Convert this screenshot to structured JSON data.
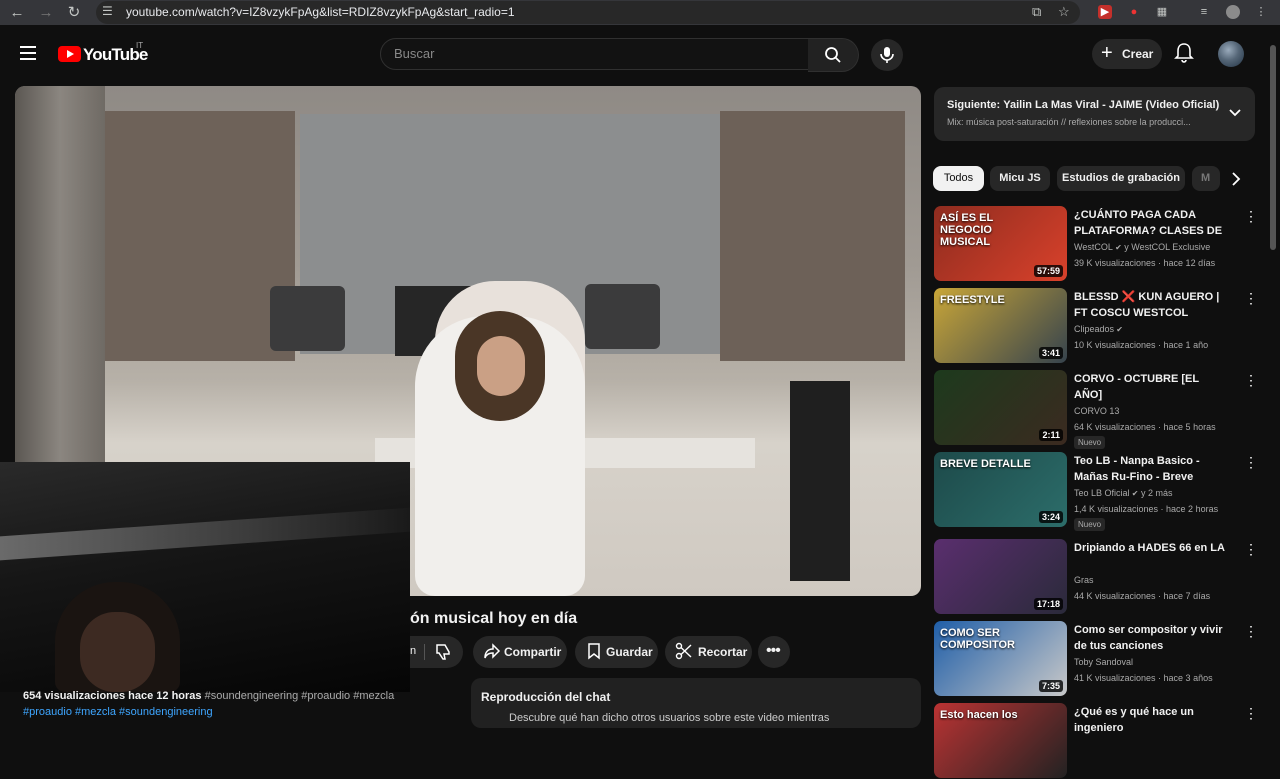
{
  "browser": {
    "url": "youtube.com/watch?v=IZ8vzykFpAg&list=RDIZ8vzykFpAg&start_radio=1"
  },
  "header": {
    "logo_text": "YouTube",
    "country_code": "IT",
    "search_placeholder": "Buscar",
    "create_label": "Crear"
  },
  "video": {
    "title_fragment": "ón musical hoy en día",
    "like_fragment": "n",
    "actions": {
      "share": "Compartir",
      "save": "Guardar",
      "clip": "Recortar"
    },
    "views": "654 visualizaciones  hace 12 horas",
    "hashtags_line1": "#soundengineering #proaudio #mezcla",
    "hashtags_line2": "#proaudio #mezcla #soundengineering"
  },
  "chat_replay": {
    "title": "Reproducción del chat",
    "subtitle": "Descubre qué han dicho otros usuarios sobre este video mientras"
  },
  "up_next": {
    "label": "Siguiente:",
    "title": "Yailin La Mas Viral - JAIME (Video Oficial)",
    "subtitle": "Mix: música post-saturación // reflexiones sobre la producci..."
  },
  "chips": [
    "Todos",
    "Micu JS",
    "Estudios de grabación",
    "M"
  ],
  "recommendations": [
    {
      "title": "¿CUÁNTO PAGA CADA PLATAFORMA? CLASES DE ...",
      "channel": "WestCOL",
      "channel_extra": " y WestCOL Exclusive",
      "verified": true,
      "meta": "39 K visualizaciones · hace 12 días",
      "duration": "57:59",
      "badge": "",
      "thumb_colors": [
        "#8e2c1f",
        "#d9412b"
      ]
    },
    {
      "title": "BLESSD ❌ KUN AGUERO | FT COSCU WESTCOL (FREESTYLE)",
      "channel": "Clipeados",
      "channel_extra": "",
      "verified": true,
      "meta": "10 K visualizaciones · hace 1 año",
      "duration": "3:41",
      "badge": "",
      "thumb_colors": [
        "#c9a638",
        "#36434d"
      ]
    },
    {
      "title": "CORVO - OCTUBRE [EL AÑO]",
      "channel": "CORVO 13",
      "channel_extra": "",
      "verified": false,
      "meta": "64 K visualizaciones · hace 5 horas",
      "duration": "2:11",
      "badge": "Nuevo",
      "thumb_colors": [
        "#1d3a1d",
        "#3b2a20"
      ]
    },
    {
      "title": "Teo LB - Nanpa Basico - Mañas Ru-Fino - Breve Detalle | Video...",
      "channel": "Teo LB Oficial",
      "channel_extra": " y 2 más",
      "verified": true,
      "meta": "1,4 K visualizaciones · hace 2 horas",
      "duration": "3:24",
      "badge": "Nuevo",
      "thumb_colors": [
        "#1d4a4a",
        "#2c6d6a"
      ]
    },
    {
      "title": "Dripiando a HADES 66 en LA",
      "channel": "Gras",
      "channel_extra": "",
      "verified": false,
      "meta": "44 K visualizaciones · hace 7 días",
      "duration": "17:18",
      "badge": "",
      "thumb_colors": [
        "#5a2e6e",
        "#2a2a3a"
      ]
    },
    {
      "title": "Como ser compositor y vivir de tus canciones",
      "channel": "Toby Sandoval",
      "channel_extra": "",
      "verified": false,
      "meta": "41 K visualizaciones · hace 3 años",
      "duration": "7:35",
      "badge": "",
      "thumb_colors": [
        "#1f5ea8",
        "#c8c8c8"
      ]
    },
    {
      "title": "¿Qué es y qué hace un ingeniero",
      "channel": "",
      "channel_extra": "",
      "verified": false,
      "meta": "",
      "duration": "",
      "badge": "",
      "thumb_colors": [
        "#b33",
        "#222"
      ]
    }
  ],
  "thumb_texts": [
    "ASÍ ES EL NEGOCIO MUSICAL",
    "FREESTYLE",
    "",
    "BREVE DETALLE",
    "",
    "COMO SER COMPOSITOR",
    "Esto hacen los"
  ]
}
